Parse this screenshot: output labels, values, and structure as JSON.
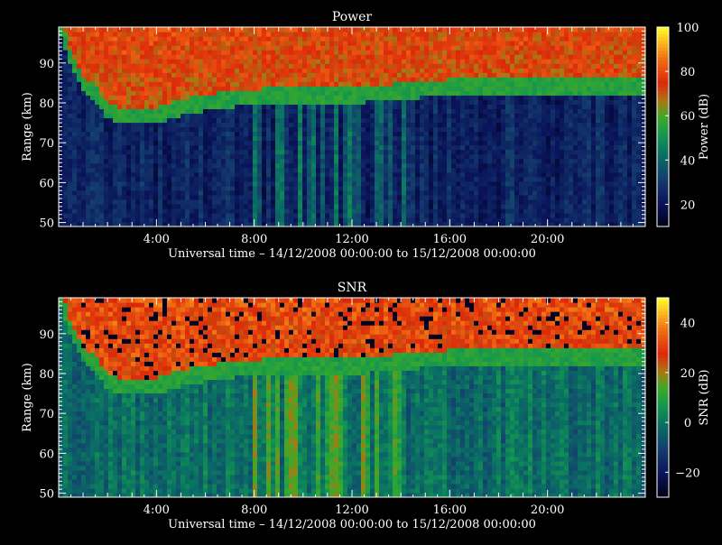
{
  "chart_data": [
    {
      "type": "heatmap",
      "title": "Power",
      "xlabel": "Universal time – 14/12/2008 00:00:00 to 15/12/2008 00:00:00",
      "ylabel": "Range (km)",
      "x_unit": "hours UT",
      "xlim": [
        0,
        24
      ],
      "x_ticks": [
        4,
        8,
        12,
        16,
        20
      ],
      "x_tick_labels": [
        "4:00",
        "8:00",
        "12:00",
        "16:00",
        "20:00"
      ],
      "ylim": [
        49,
        99
      ],
      "y_ticks": [
        50,
        60,
        70,
        80,
        90
      ],
      "y_tick_labels": [
        "50",
        "60",
        "70",
        "80",
        "90"
      ],
      "colorbar": {
        "label": "Power (dB)",
        "range": [
          10,
          100
        ],
        "ticks": [
          20,
          40,
          60,
          80,
          100
        ],
        "tick_labels": [
          "20",
          "40",
          "60",
          "80",
          "100"
        ]
      },
      "layer_boundary_km": [
        {
          "x": 0.2,
          "y": 96
        },
        {
          "x": 0.5,
          "y": 90
        },
        {
          "x": 1.0,
          "y": 84
        },
        {
          "x": 1.7,
          "y": 80
        },
        {
          "x": 2.0,
          "y": 77
        },
        {
          "x": 2.5,
          "y": 76
        },
        {
          "x": 4.0,
          "y": 76
        },
        {
          "x": 5.0,
          "y": 78
        },
        {
          "x": 7.0,
          "y": 80
        },
        {
          "x": 9.0,
          "y": 81
        },
        {
          "x": 12.0,
          "y": 81
        },
        {
          "x": 14.0,
          "y": 82
        },
        {
          "x": 16.0,
          "y": 83
        },
        {
          "x": 20.0,
          "y": 83
        },
        {
          "x": 24.0,
          "y": 83
        }
      ]
    },
    {
      "type": "heatmap",
      "title": "SNR",
      "xlabel": "Universal time – 14/12/2008 00:00:00 to 15/12/2008 00:00:00",
      "ylabel": "Range (km)",
      "x_unit": "hours UT",
      "xlim": [
        0,
        24
      ],
      "x_ticks": [
        4,
        8,
        12,
        16,
        20
      ],
      "x_tick_labels": [
        "4:00",
        "8:00",
        "12:00",
        "16:00",
        "20:00"
      ],
      "ylim": [
        49,
        99
      ],
      "y_ticks": [
        50,
        60,
        70,
        80,
        90
      ],
      "y_tick_labels": [
        "50",
        "60",
        "70",
        "80",
        "90"
      ],
      "colorbar": {
        "label": "SNR (dB)",
        "range": [
          -30,
          50
        ],
        "ticks": [
          -20,
          0,
          20,
          40
        ],
        "tick_labels": [
          "−20",
          "0",
          "20",
          "40"
        ]
      },
      "layer_boundary_km": [
        {
          "x": 0.2,
          "y": 96
        },
        {
          "x": 0.5,
          "y": 90
        },
        {
          "x": 1.0,
          "y": 84
        },
        {
          "x": 1.7,
          "y": 80
        },
        {
          "x": 2.0,
          "y": 77
        },
        {
          "x": 2.5,
          "y": 76
        },
        {
          "x": 4.0,
          "y": 76
        },
        {
          "x": 5.0,
          "y": 78
        },
        {
          "x": 7.0,
          "y": 80
        },
        {
          "x": 9.0,
          "y": 81
        },
        {
          "x": 12.0,
          "y": 81
        },
        {
          "x": 14.0,
          "y": 82
        },
        {
          "x": 16.0,
          "y": 83
        },
        {
          "x": 20.0,
          "y": 83
        },
        {
          "x": 24.0,
          "y": 83
        }
      ]
    }
  ]
}
